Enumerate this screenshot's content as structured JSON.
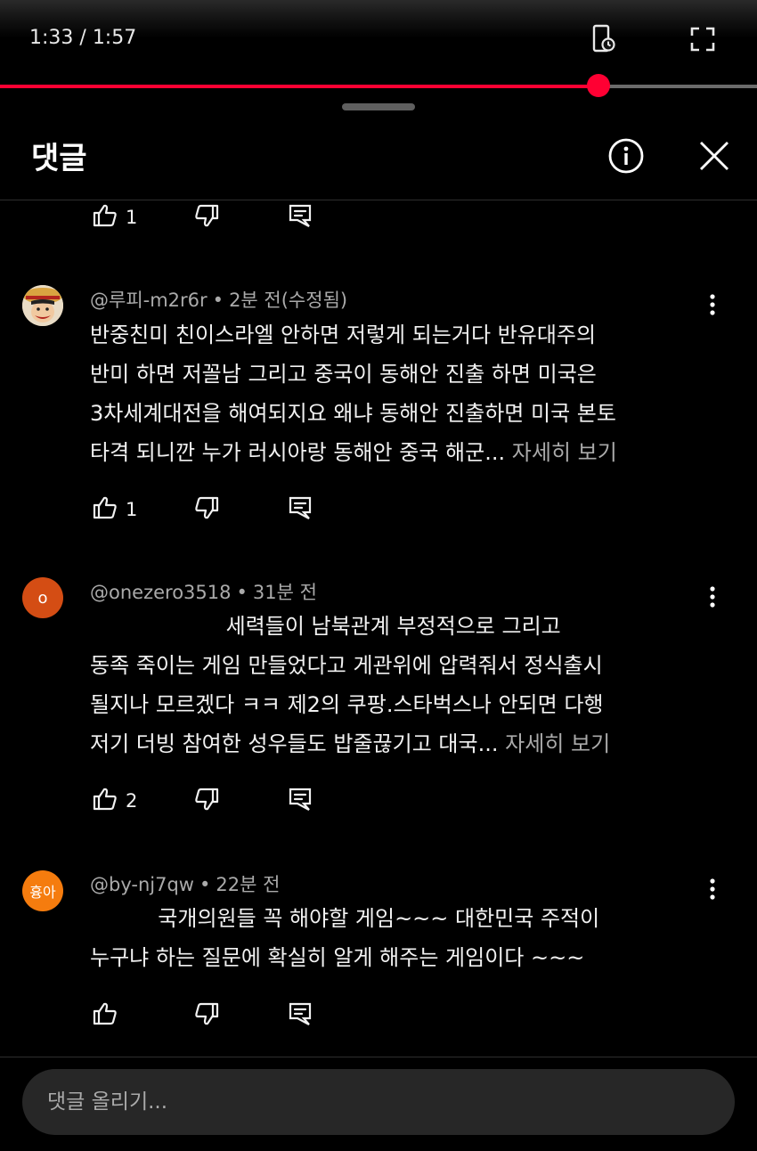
{
  "player": {
    "time_current": "1:33",
    "time_total": "1:57",
    "progress": 0.79,
    "icons": [
      "playback-settings-icon",
      "fullscreen-icon"
    ],
    "accent_color": "#ff0033"
  },
  "header": {
    "title": "댓글",
    "icons": [
      "info-icon",
      "close-icon"
    ]
  },
  "partial_actions": {
    "like_count": "1"
  },
  "comments": [
    {
      "author": "@루피-m2r6r",
      "time": "2분 전(수정됨)",
      "avatar": "luffy-avatar",
      "text": "반중친미 친이스라엘 안하면 저렇게 되는거다 반유대주의\n반미 하면 저꼴남 그리고 중국이 동해안 진출 하면 미국은\n3차세계대전을 해여되지요 왜냐 동해안 진출하면 미국 본토\n타격 되니깐 누가 러시아랑 동해안 중국 해군...",
      "more": "자세히 보기",
      "like_count": "1"
    },
    {
      "author": "@onezero3518",
      "time": "31분 전",
      "avatar_letter": "o",
      "avatar_color": "#d44d14",
      "text": "                    세력들이 남북관계 부정적으로 그리고\n동족 죽이는 게임 만들었다고 게관위에 압력줘서 정식출시\n될지나 모르겠다 ㅋㅋ 제2의 쿠팡.스타벅스나 안되면 다행\n저기 더빙 참여한 성우들도 밥줄끊기고 대국...",
      "more": "자세히 보기",
      "like_count": "2"
    },
    {
      "author": "@by-nj7qw",
      "time": "22분 전",
      "avatar_letter": "흉아",
      "avatar_color": "#f57c0e",
      "text": "          국개의원들 꼭 해야할 게임~~~ 대한민국 주적이\n누구냐 하는 질문에 확실히 알게 해주는 게임이다 ~~~",
      "more": "",
      "like_count": ""
    }
  ],
  "input": {
    "placeholder": "댓글 올리기..."
  },
  "colors": {
    "background": "#000000",
    "secondary_text": "#aaaaaa",
    "input_bg": "#272727"
  }
}
